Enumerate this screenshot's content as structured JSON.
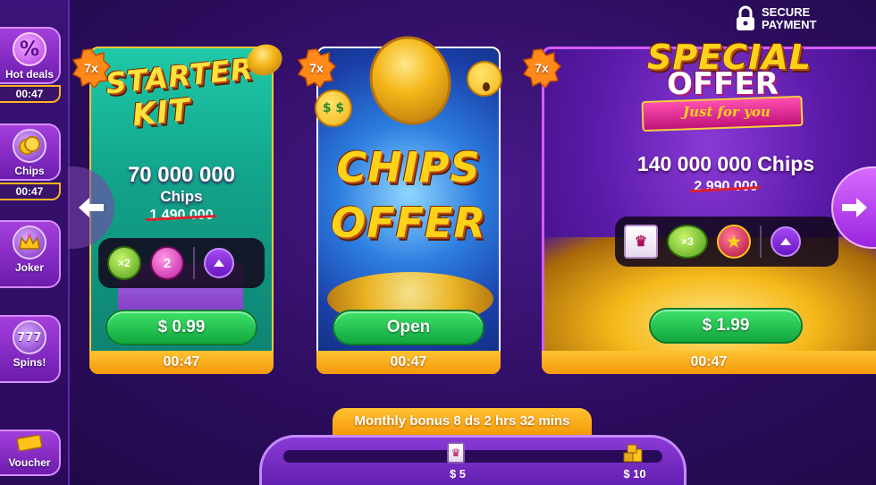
{
  "sidebar": {
    "items": [
      {
        "label": "Hot deals",
        "icon": "percent-icon",
        "symbol": "%",
        "timer": "00:47"
      },
      {
        "label": "Chips",
        "icon": "chips-icon",
        "symbol": "",
        "timer": "00:47"
      },
      {
        "label": "Joker",
        "icon": "crown-icon",
        "symbol": "",
        "timer": ""
      },
      {
        "label": "Spins!",
        "icon": "slots-777-icon",
        "symbol": "777",
        "timer": ""
      },
      {
        "label": "Voucher",
        "icon": "voucher-icon",
        "symbol": "",
        "timer": ""
      }
    ]
  },
  "secure": {
    "line1": "SECURE",
    "line2": "PAYMENT",
    "icon": "lock-icon"
  },
  "cards": {
    "starter": {
      "badge": "7x",
      "title_line1": "STARTER",
      "title_line2": "KIT",
      "amount": "70 000 000",
      "unit": "Chips",
      "old_amount": "1 490 000",
      "perks": [
        "×2",
        "2"
      ],
      "price": "$ 0.99",
      "timer": "00:47"
    },
    "chips_offer": {
      "badge": "7x",
      "title_line1": "CHIPS",
      "title_line2": "OFFER",
      "button": "Open",
      "timer": "00:47"
    },
    "special": {
      "badge": "7x",
      "title_line1": "SPECIAL",
      "title_line2": "OFFER",
      "subtitle": "Just for you",
      "amount": "140 000 000 Chips",
      "old_amount": "2 990 000",
      "perks": [
        "",
        "×3",
        ""
      ],
      "price": "$ 1.99",
      "timer": "00:47"
    }
  },
  "monthly": {
    "label": "Monthly bonus 8 ds 2 hrs 32 mins",
    "progress": 0,
    "milestones": [
      {
        "price": "$ 5"
      },
      {
        "price": "$ 10"
      }
    ]
  },
  "colors": {
    "accent_orange": "#f59a0c",
    "buy_green": "#12a63e",
    "purple": "#6c1cad"
  }
}
